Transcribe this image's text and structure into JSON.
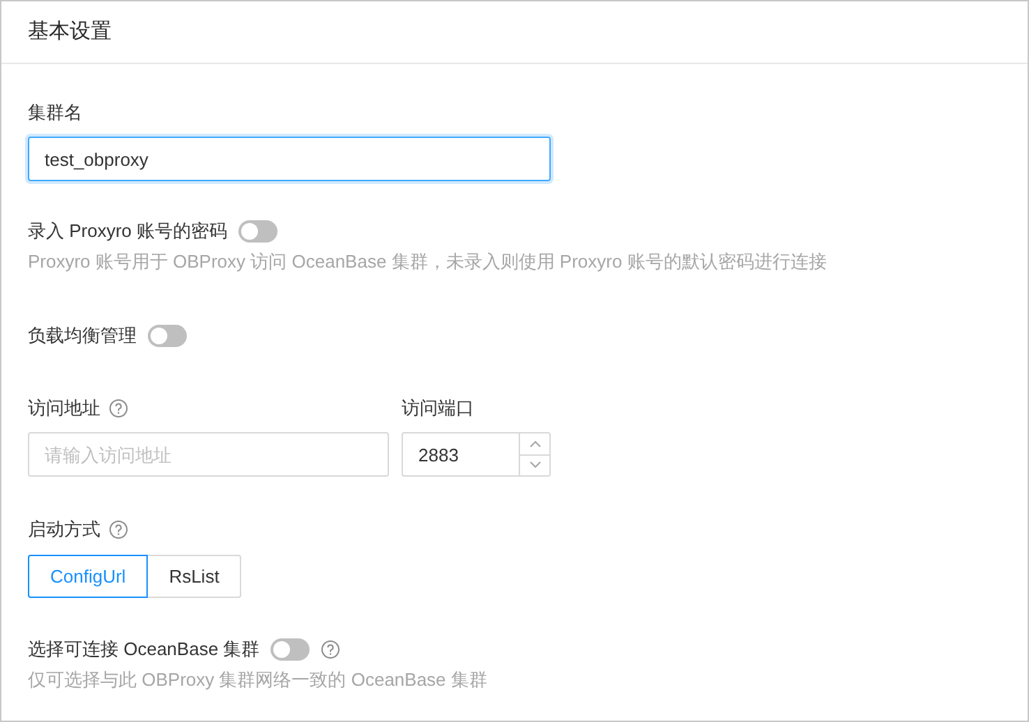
{
  "card": {
    "title": "基本设置"
  },
  "cluster_name": {
    "label": "集群名",
    "value": "test_obproxy"
  },
  "proxyro_password": {
    "label": "录入 Proxyro 账号的密码",
    "on": false,
    "help": "Proxyro 账号用于 OBProxy 访问 OceanBase 集群，未录入则使用 Proxyro 账号的默认密码进行连接"
  },
  "load_balancing": {
    "label": "负载均衡管理",
    "on": false
  },
  "access_address": {
    "label": "访问地址",
    "placeholder": "请输入访问地址"
  },
  "access_port": {
    "label": "访问端口",
    "value": "2883"
  },
  "startup_mode": {
    "label": "启动方式",
    "options": [
      {
        "label": "ConfigUrl",
        "selected": true
      },
      {
        "label": "RsList",
        "selected": false
      }
    ]
  },
  "connectable_cluster": {
    "label": "选择可连接 OceanBase 集群",
    "on": false,
    "help": "仅可选择与此 OBProxy 集群网络一致的 OceanBase 集群"
  }
}
